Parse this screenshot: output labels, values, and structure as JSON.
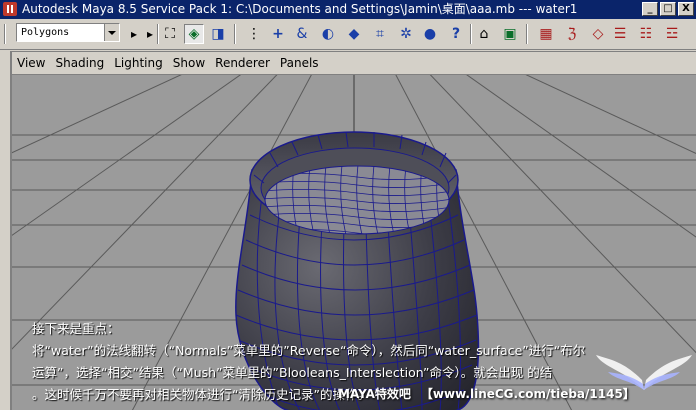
{
  "window": {
    "title": "Autodesk Maya 8.5 Service Pack 1: C:\\Documents and Settings\\Jamin\\桌面\\aaa.mb   ---   water1",
    "minimize": "_",
    "maximize": "□",
    "close": "X"
  },
  "toolbar": {
    "mode_select": "Polygons",
    "icons": [
      "select-by-hierarchy-icon",
      "select-by-object-icon",
      "select-by-component-icon",
      "snap-to-grid-icon",
      "snap-to-curve-icon",
      "snap-to-point-icon",
      "snap-to-view-plane-icon",
      "make-live-icon",
      "history-icon",
      "render-icon",
      "ipr-icon",
      "render-settings-icon",
      "hypershade-icon",
      "help-icon",
      "lock-icon",
      "channel-box-icon",
      "attribute-editor-icon",
      "tool-settings-icon",
      "layer-editor-icon",
      "outliner-icon"
    ]
  },
  "panel_menu": [
    "View",
    "Shading",
    "Lighting",
    "Show",
    "Renderer",
    "Panels"
  ],
  "overlay": {
    "line1": "接下来是重点：",
    "line2": "将“water”的法线翻转（“Normals”菜单里的”Reverse“命令），然后同“water_surface”进行“布尔",
    "line3": "运算”，选择“相交”结果（“Mush”菜单里的”Blooleans_Interslection”命令）。就会出现       的结",
    "line4": "。这时候千万不要再对相关物体进行“清除历史记录”的操作。"
  },
  "watermark": {
    "brand": "MAYA特效吧",
    "site": "【www.lineCG.com/tieba/1145】"
  },
  "colors": {
    "titlebar": "#0a246a",
    "chrome": "#d4d0c8",
    "viewport_bg": "#9b9b9b",
    "mesh_wire": "#1a1a8c"
  }
}
